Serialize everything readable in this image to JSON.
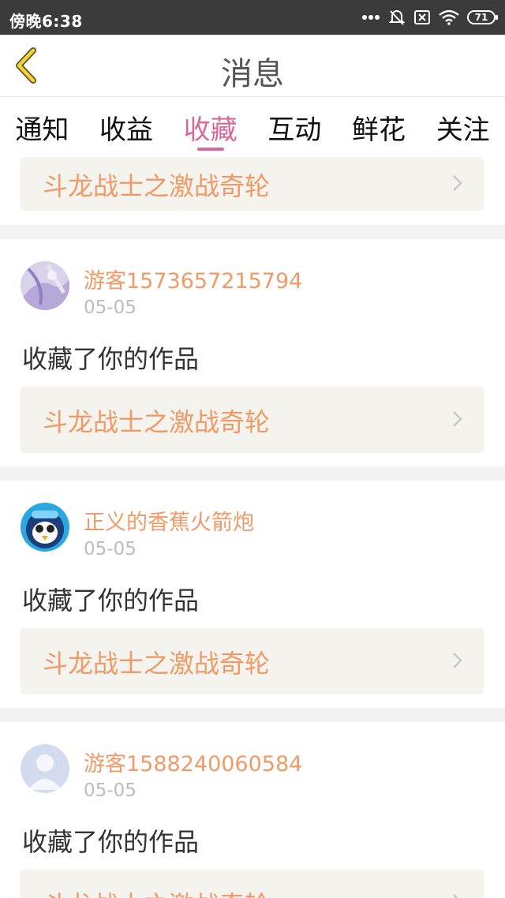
{
  "status_bar": {
    "time": "傍晚6:38",
    "battery": "71"
  },
  "header": {
    "title": "消息"
  },
  "tabs": [
    {
      "label": "通知",
      "active": false
    },
    {
      "label": "收益",
      "active": false
    },
    {
      "label": "收藏",
      "active": true
    },
    {
      "label": "互动",
      "active": false
    },
    {
      "label": "鲜花",
      "active": false
    },
    {
      "label": "关注",
      "active": false
    }
  ],
  "partial_item": {
    "work_title": "斗龙战士之激战奇轮"
  },
  "messages": [
    {
      "username": "游客1573657215794",
      "date": "05-05",
      "action": "收藏了你的作品",
      "work_title": "斗龙战士之激战奇轮",
      "avatar": "anime-character-avatar"
    },
    {
      "username": "正义的香蕉火箭炮",
      "date": "05-05",
      "action": "收藏了你的作品",
      "work_title": "斗龙战士之激战奇轮",
      "avatar": "penguin-robot-avatar"
    },
    {
      "username": "游客1588240060584",
      "date": "05-05",
      "action": "收藏了你的作品",
      "work_title": "斗龙战士之激战奇轮",
      "avatar": "default-user-avatar"
    }
  ],
  "colors": {
    "accent": "#d9689a",
    "orange_text": "#ef9a67",
    "card_bg": "#f4f3ed",
    "status_bar": "#3b3b3b"
  }
}
